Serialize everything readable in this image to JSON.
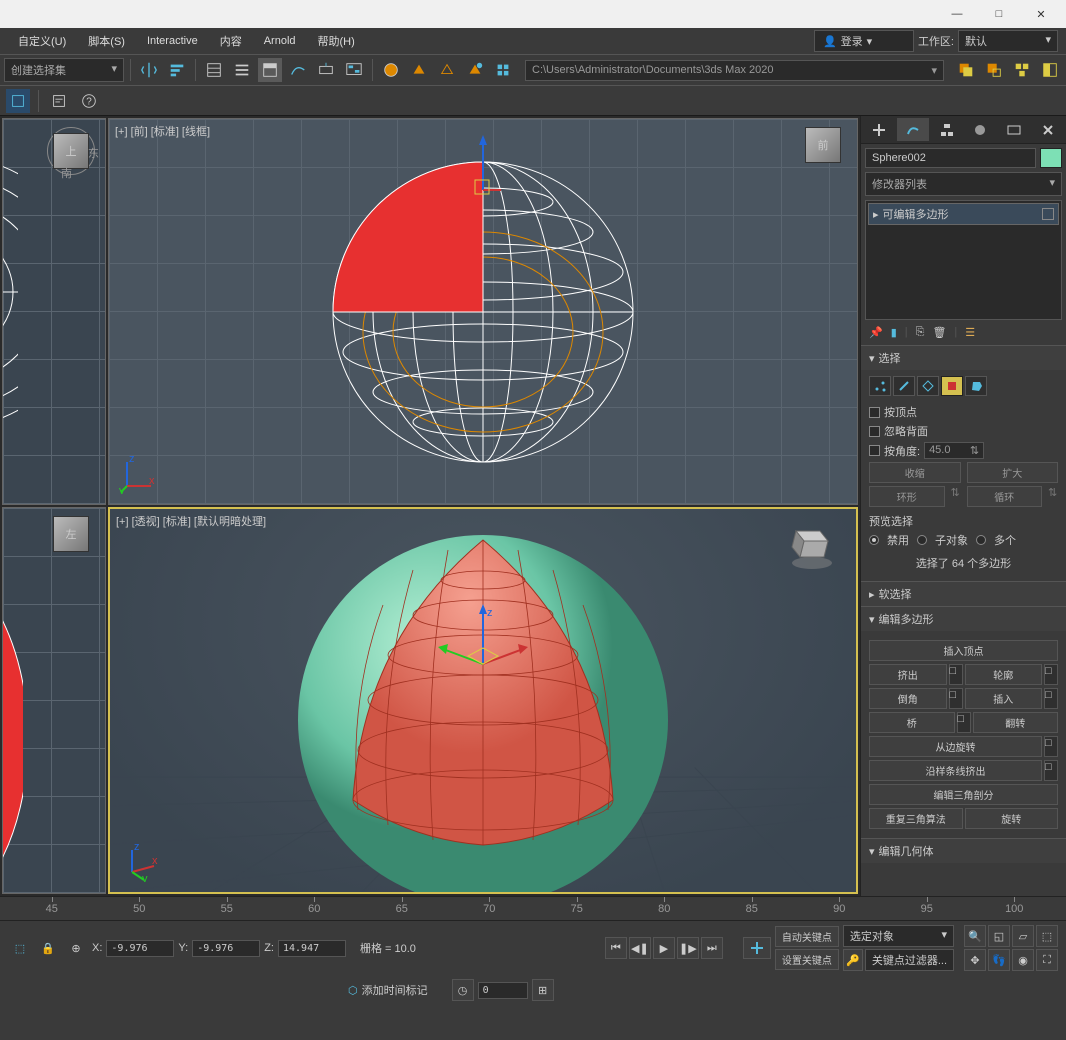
{
  "titlebar": {
    "min": "—",
    "max": "□",
    "close": "✕"
  },
  "menu": {
    "customize": "自定义(U)",
    "script": "脚本(S)",
    "interactive": "Interactive",
    "content": "内容",
    "arnold": "Arnold",
    "help": "帮助(H)"
  },
  "login": {
    "icon": "👤",
    "label": "登录"
  },
  "workspace": {
    "label": "工作区:",
    "value": "默认"
  },
  "toolbar": {
    "selection_set": "创建选择集",
    "path": "C:\\Users\\Administrator\\Documents\\3ds Max 2020"
  },
  "viewport": {
    "top_label": "[+] [前] [标准] [线框]",
    "persp_label": "[+] [透视] [标准] [默认明暗处理]",
    "front_cube": "前",
    "top_cube": "上",
    "left_cube": "左",
    "east": "东",
    "south": "南"
  },
  "side": {
    "object_name": "Sphere002",
    "modifier_list": "修改器列表",
    "editable_poly": "可编辑多边形",
    "selection": {
      "title": "选择",
      "by_vertex": "按顶点",
      "ignore_backfacing": "忽略背面",
      "by_angle": "按角度:",
      "angle_value": "45.0",
      "shrink": "收缩",
      "grow": "扩大",
      "ring": "环形",
      "loop": "循环",
      "preview_label": "预览选择",
      "disabled": "禁用",
      "subobj": "子对象",
      "multi": "多个",
      "selected_info": "选择了 64 个多边形"
    },
    "soft_selection": "软选择",
    "edit_polygons": {
      "title": "编辑多边形",
      "insert_vertex": "插入顶点",
      "extrude": "挤出",
      "outline": "轮廓",
      "bevel": "倒角",
      "inset": "插入",
      "bridge": "桥",
      "flip": "翻转",
      "hinge": "从边旋转",
      "extrude_spline": "沿样条线挤出",
      "edit_tri": "编辑三角剖分",
      "retri": "重复三角算法",
      "turn": "旋转"
    },
    "edit_geometry": "编辑几何体"
  },
  "timeline": {
    "ticks": [
      "45",
      "50",
      "55",
      "60",
      "65",
      "70",
      "75",
      "80",
      "85",
      "90",
      "95",
      "100"
    ]
  },
  "status": {
    "x_label": "X:",
    "x": "-9.976",
    "y_label": "Y:",
    "y": "-9.976",
    "z_label": "Z:",
    "z": "14.947",
    "grid": "栅格 = 10.0",
    "add_time_tag": "添加时间标记",
    "auto_key": "自动关键点",
    "set_key": "设置关键点",
    "sel_obj": "选定对象",
    "key_filter": "关键点过滤器..."
  }
}
